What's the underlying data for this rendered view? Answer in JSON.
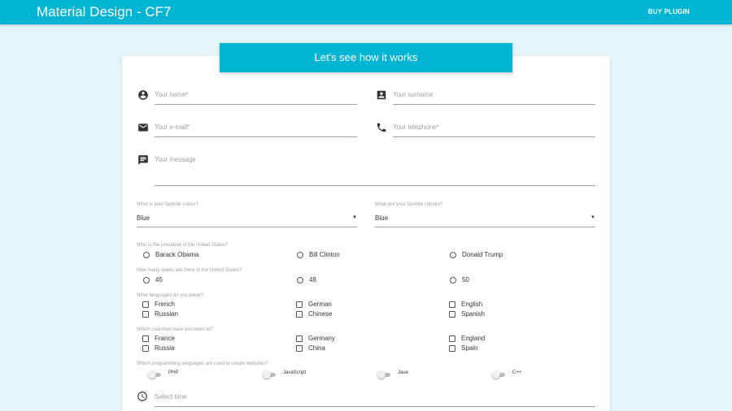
{
  "header": {
    "title": "Material Design - CF7",
    "buy_label": "BUY PLUGIN",
    "accent_color": "#00b4d3"
  },
  "card": {
    "title": "Let's see how it works"
  },
  "fields": {
    "name": {
      "placeholder": "Your name*",
      "icon": "account-circle-icon"
    },
    "surname": {
      "placeholder": "Your surname",
      "icon": "contact-card-icon"
    },
    "email": {
      "placeholder": "Your e-mail*",
      "icon": "email-icon"
    },
    "telephone": {
      "placeholder": "Your telephone*",
      "icon": "phone-icon"
    },
    "message": {
      "placeholder": "Your message",
      "icon": "message-icon"
    },
    "time": {
      "placeholder": "Select time",
      "icon": "clock-icon"
    }
  },
  "selects": {
    "colour": {
      "label": "What is your favorite colour?",
      "value": "Blue"
    },
    "colours": {
      "label": "What are your favorite colours?",
      "value": "Blue"
    }
  },
  "questions": {
    "president": {
      "label": "Who is the president of the United States?",
      "options": [
        "Barack Obama",
        "Bill Clinton",
        "Donald Trump"
      ]
    },
    "states": {
      "label": "How many states are there in the United States?",
      "options": [
        "45",
        "48",
        "50"
      ]
    },
    "languages": {
      "label": "What languages do you know?",
      "options": [
        "French",
        "Russian",
        "German",
        "Chinese",
        "English",
        "Spanish"
      ]
    },
    "countries": {
      "label": "Which countries have you been to?",
      "options": [
        "France",
        "Russia",
        "Germany",
        "China",
        "England",
        "Spain"
      ]
    },
    "programming": {
      "label": "Which programming languages are used to create websites?",
      "options": [
        "PHP",
        "JavaScript",
        "Java",
        "C++"
      ]
    }
  }
}
